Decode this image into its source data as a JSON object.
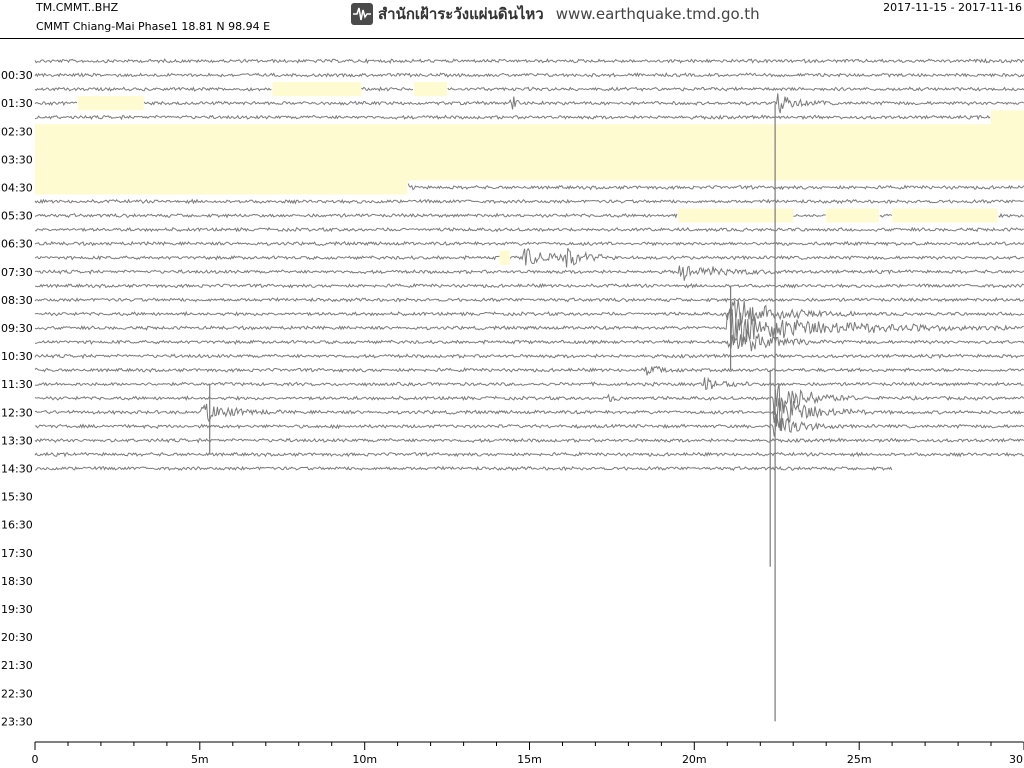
{
  "header": {
    "station_code": "TM.CMMT..BHZ",
    "station_name": "CMMT Chiang-Mai Phase1  18.81 N 98.94 E",
    "agency_thai": "สำนักเฝ้าระวังแผ่นดินไหว",
    "website": "www.earthquake.tmd.go.th",
    "date_range": "2017-11-15 - 2017-11-16",
    "logo_icon": "seismograph-logo-icon"
  },
  "colors": {
    "trace": "#7a7a7a",
    "gap_fill": "#fffbd0",
    "axis": "#000000",
    "header_rule": "#000000"
  },
  "chart_data": {
    "type": "helicorder",
    "row_span_minutes": 30,
    "x_axis": {
      "range": [
        0,
        30
      ],
      "unit": "minutes",
      "tick_labels": [
        "0",
        "5m",
        "10m",
        "15m",
        "20m",
        "25m",
        "30"
      ]
    },
    "y_axis": {
      "tick_labels": [
        "00:30",
        "01:30",
        "02:30",
        "03:30",
        "04:30",
        "05:30",
        "06:30",
        "07:30",
        "08:30",
        "09:30",
        "10:30",
        "11:30",
        "12:30",
        "13:30",
        "14:30",
        "15:30",
        "16:30",
        "17:30",
        "18:30",
        "19:30",
        "20:30",
        "21:30",
        "22:30",
        "23:30"
      ]
    },
    "recording_end": {
      "row": 29,
      "minute": 26.0
    },
    "data_gaps": [
      {
        "row": 2,
        "start": 7.2,
        "end": 9.9
      },
      {
        "row": 2,
        "start": 11.5,
        "end": 12.5
      },
      {
        "row": 3,
        "start": 1.3,
        "end": 3.3
      },
      {
        "row": 4,
        "start": 29.0,
        "end": 30.0
      },
      {
        "row": 5,
        "start": 0.0,
        "end": 30.0
      },
      {
        "row": 6,
        "start": 0.0,
        "end": 30.0
      },
      {
        "row": 7,
        "start": 0.0,
        "end": 30.0
      },
      {
        "row": 8,
        "start": 0.0,
        "end": 30.0
      },
      {
        "row": 9,
        "start": 0.0,
        "end": 11.3
      },
      {
        "row": 11,
        "start": 19.5,
        "end": 23.0
      },
      {
        "row": 11,
        "start": 24.0,
        "end": 25.6
      },
      {
        "row": 11,
        "start": 26.0,
        "end": 29.2
      },
      {
        "row": 14,
        "start": 14.1,
        "end": 14.4
      }
    ],
    "events": [
      {
        "row": 3,
        "minute": 14.4,
        "amplitude": 14,
        "duration": 0.5
      },
      {
        "row": 3,
        "minute": 22.5,
        "amplitude": 12,
        "duration": 1.5
      },
      {
        "row": 9,
        "minute": 11.3,
        "amplitude": 8,
        "duration": 0.3
      },
      {
        "row": 14,
        "minute": 14.8,
        "amplitude": 12,
        "duration": 2.5
      },
      {
        "row": 14,
        "minute": 16.1,
        "amplitude": 12,
        "duration": 1.5
      },
      {
        "row": 15,
        "minute": 19.5,
        "amplitude": 10,
        "duration": 3.5
      },
      {
        "row": 18,
        "minute": 21.0,
        "amplitude": 22,
        "duration": 4.0
      },
      {
        "row": 19,
        "minute": 21.0,
        "amplitude": 22,
        "duration": 8.5
      },
      {
        "row": 20,
        "minute": 21.0,
        "amplitude": 12,
        "duration": 3.0
      },
      {
        "row": 20,
        "minute": 21.5,
        "amplitude": 10,
        "duration": 2.0
      },
      {
        "row": 22,
        "minute": 18.5,
        "amplitude": 6,
        "duration": 1.5
      },
      {
        "row": 23,
        "minute": 20.3,
        "amplitude": 9,
        "duration": 1.5
      },
      {
        "row": 24,
        "minute": 17.3,
        "amplitude": 5,
        "duration": 0.8
      },
      {
        "row": 25,
        "minute": 5.0,
        "amplitude": 14,
        "duration": 2.5
      },
      {
        "row": 24,
        "minute": 22.4,
        "amplitude": 26,
        "duration": 2.5
      },
      {
        "row": 25,
        "minute": 22.4,
        "amplitude": 28,
        "duration": 2.8
      },
      {
        "row": 26,
        "minute": 22.4,
        "amplitude": 20,
        "duration": 2.0
      }
    ],
    "spikes": [
      {
        "minute": 22.45,
        "top_row": 3,
        "bottom_row": 47
      },
      {
        "minute": 22.3,
        "top_row": 22,
        "bottom_row": 36
      },
      {
        "minute": 5.3,
        "top_row": 23,
        "bottom_row": 28
      },
      {
        "minute": 21.1,
        "top_row": 16,
        "bottom_row": 22
      }
    ]
  }
}
